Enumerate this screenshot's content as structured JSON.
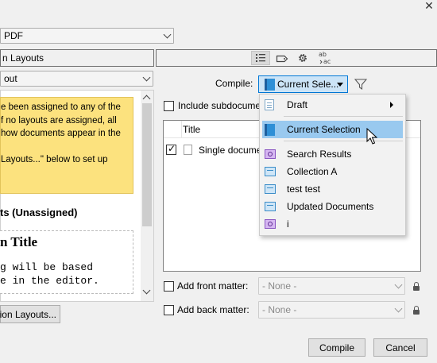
{
  "window": {
    "close_glyph": "✕"
  },
  "format_select": {
    "value": "PDF"
  },
  "left": {
    "layouts_header": "n Layouts",
    "layout_select": {
      "value": "out"
    },
    "notice_lines": [
      "e been assigned to any of the",
      "f no layouts are assigned, all",
      " how documents appear in the",
      "",
      "Layouts...\" below to set up"
    ],
    "section_title": "ts (Unassigned)",
    "preview_title": "n Title",
    "preview_lines": [
      "g will be based",
      "e in the editor."
    ],
    "button_label": "ion Layouts..."
  },
  "right": {
    "toolbar_icons": [
      "list-icon",
      "tag-icon",
      "gear-icon",
      "spelling-icon"
    ],
    "compile_label": "Compile:",
    "compile_select": {
      "value": "Current Sele..."
    },
    "include_label": "Include subdocume",
    "table": {
      "column_title": "Title",
      "rows": [
        {
          "checked": true,
          "title": "Single docume"
        }
      ]
    },
    "front_matter": {
      "label": "Add front matter:",
      "value": "- None -"
    },
    "back_matter": {
      "label": "Add back matter:",
      "value": "- None -"
    },
    "buttons": {
      "compile": "Compile",
      "cancel": "Cancel"
    }
  },
  "dropdown_menu": {
    "items": [
      {
        "label": "Draft",
        "icon": "draft-doc-icon",
        "submenu": true,
        "selected": false
      },
      {
        "label": "Current Selection",
        "icon": "current-selection-icon",
        "submenu": false,
        "selected": true
      },
      {
        "label": "Search Results",
        "icon": "search-collection-icon",
        "submenu": false,
        "selected": false
      },
      {
        "label": "Collection A",
        "icon": "collection-icon",
        "submenu": false,
        "selected": false
      },
      {
        "label": "test test",
        "icon": "collection-icon",
        "submenu": false,
        "selected": false
      },
      {
        "label": "Updated Documents",
        "icon": "collection-icon",
        "submenu": false,
        "selected": false
      },
      {
        "label": "i",
        "icon": "search-collection-icon",
        "submenu": false,
        "selected": false
      }
    ]
  },
  "colors": {
    "selection": "#99c9ef",
    "notice_bg": "#fce27e",
    "select_highlight": "#cce4f7"
  }
}
